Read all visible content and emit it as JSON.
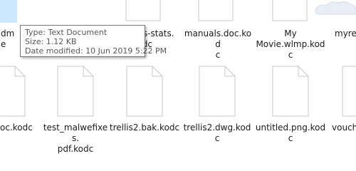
{
  "files_row1": [
    {
      "name": "dme"
    },
    {
      "name": "ma...nes-stats.\nkodc"
    },
    {
      "name": "manuals.doc.kod\nc"
    },
    {
      "name": "My\nMovie.wlmp.kod\nc"
    },
    {
      "name": "myres"
    }
  ],
  "files_row2": [
    {
      "name": "oc.kodc"
    },
    {
      "name": "test_malwefixes.\npdf.kodc"
    },
    {
      "name": "trellis2.bak.kodc"
    },
    {
      "name": "trellis2.dwg.kodc"
    },
    {
      "name": "untitled.png.kod\nc"
    },
    {
      "name": "vouch"
    }
  ],
  "tooltip": {
    "type": "Type: Text Document",
    "size": "Size: 1.12 KB",
    "date": "Date modified: 10 Jun 2019 5:22 PM"
  },
  "colors": {
    "selection": "#cce8ff",
    "icon_fill": "#ffffff",
    "icon_border": "#c8c8c8"
  },
  "icons": {
    "file": "document-icon",
    "top_right": "cloud-icon"
  }
}
